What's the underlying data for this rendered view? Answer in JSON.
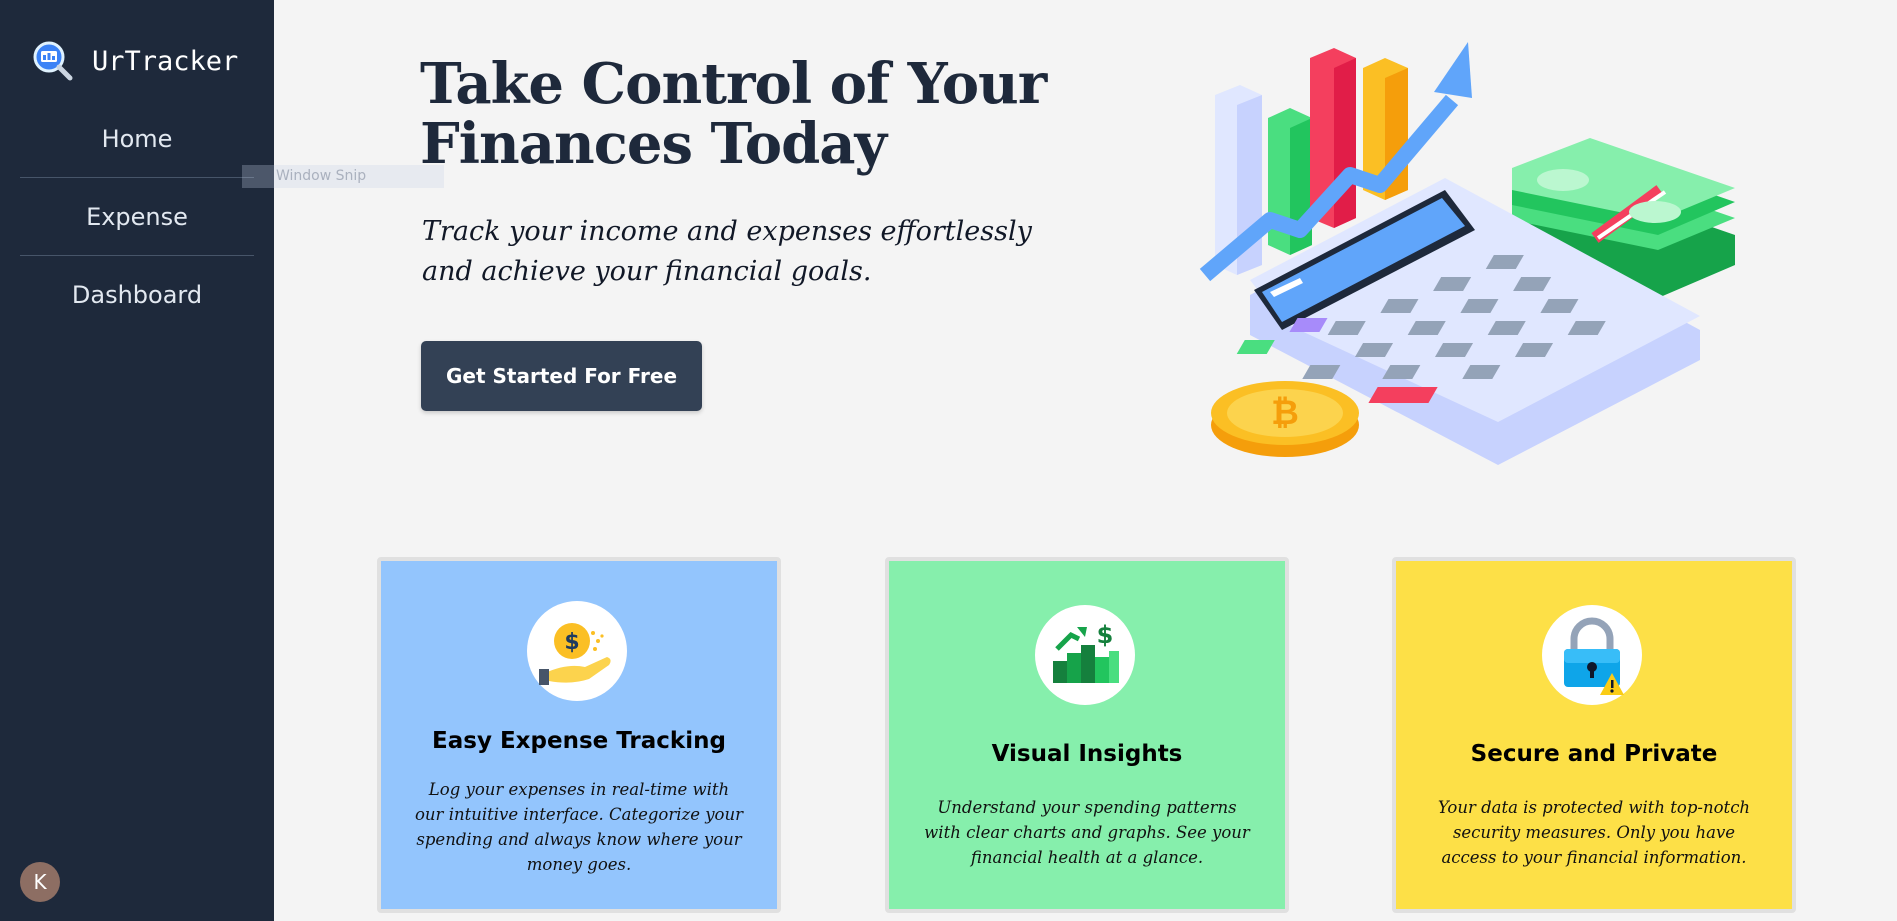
{
  "sidebar": {
    "brand_name": "UrTracker",
    "brand_icon": "magnifier-chart-icon",
    "nav_items": [
      {
        "label": "Home"
      },
      {
        "label": "Expense"
      },
      {
        "label": "Dashboard"
      }
    ],
    "avatar_initial": "K"
  },
  "overlay": {
    "snip_text": "Window Snip"
  },
  "hero": {
    "title": "Take Control of Your Finances Today",
    "subtitle": "Track your income and expenses effortlessly and achieve your financial goals.",
    "cta_label": "Get Started For Free",
    "illustration": "finance-illustration"
  },
  "features": [
    {
      "title": "Easy Expense Tracking",
      "description": "Log your expenses in real-time with our intuitive interface. Categorize your spending and always know where your money goes.",
      "icon": "coin-hand-icon",
      "color": "#93c5fd"
    },
    {
      "title": "Visual Insights",
      "description": "Understand your spending patterns with clear charts and graphs. See your financial health at a glance.",
      "icon": "growth-chart-icon",
      "color": "#86efac"
    },
    {
      "title": "Secure and Private",
      "description": "Your data is protected with top-notch security measures. Only you have access to your financial information.",
      "icon": "padlock-icon",
      "color": "#fde047"
    }
  ],
  "colors": {
    "sidebar_bg": "#1e293b",
    "page_bg": "#f4f4f4",
    "cta_bg": "#334155"
  }
}
